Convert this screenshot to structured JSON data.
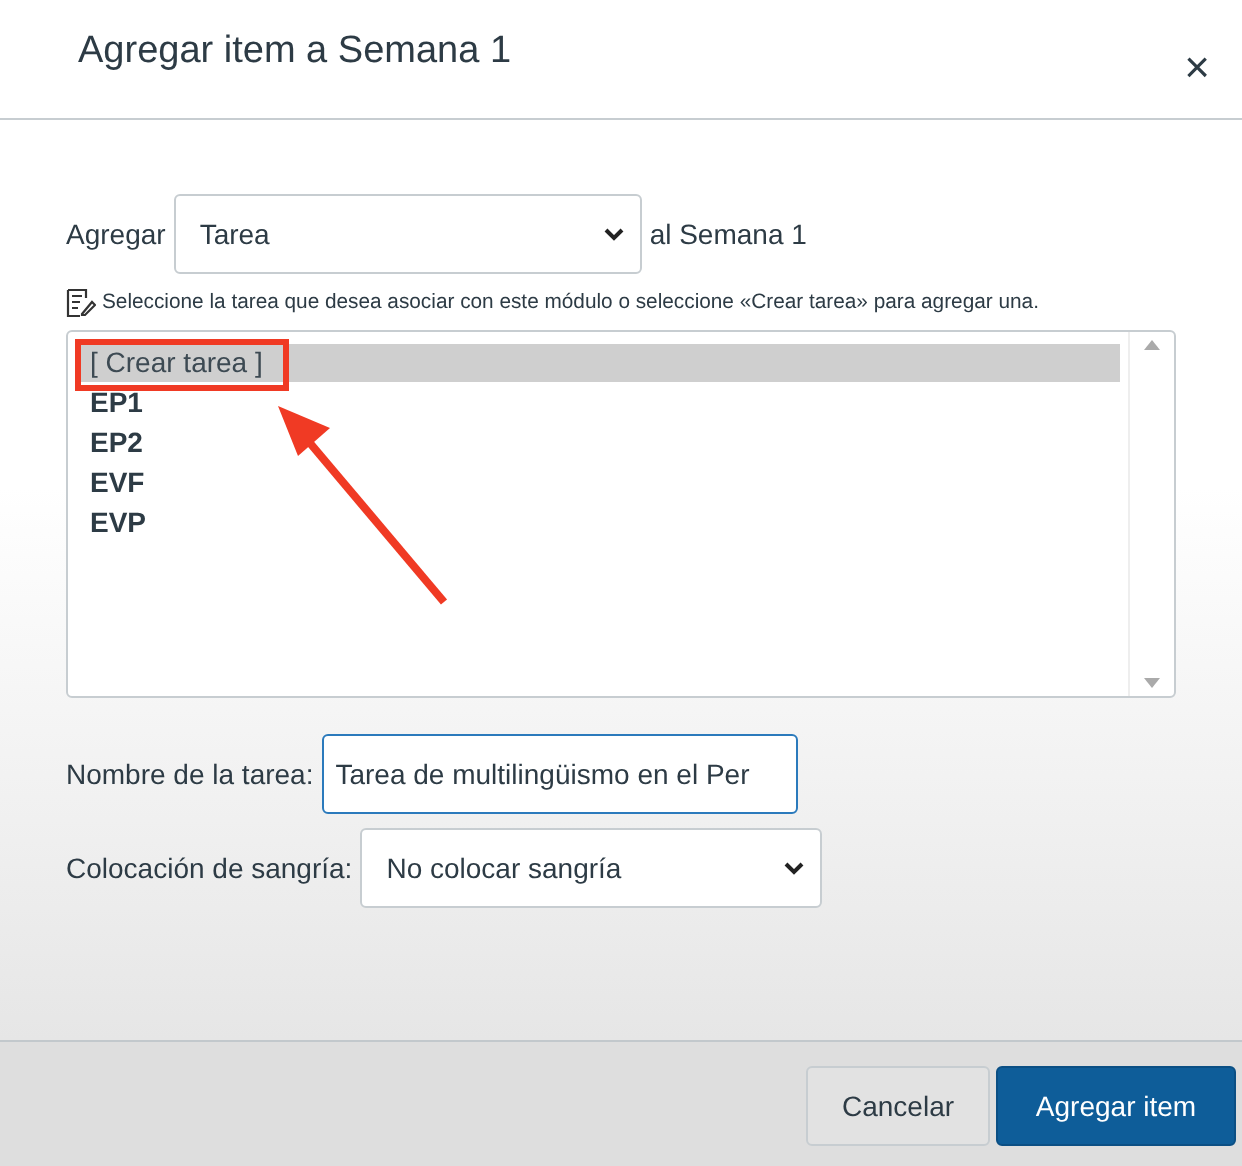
{
  "dialog": {
    "title": "Agregar item a Semana 1",
    "close": "×"
  },
  "add_row": {
    "label": "Agregar",
    "type_select": "Tarea",
    "suffix": "al Semana 1"
  },
  "hint": "Seleccione la tarea que desea asociar con este módulo o seleccione «Crear tarea» para agregar una.",
  "list_items": [
    {
      "label": "[ Crear tarea ]",
      "selected": true
    },
    {
      "label": "EP1",
      "selected": false
    },
    {
      "label": "EP2",
      "selected": false
    },
    {
      "label": "EVF",
      "selected": false
    },
    {
      "label": "EVP",
      "selected": false
    }
  ],
  "name_field": {
    "label": "Nombre de la tarea:",
    "value": "Tarea de multilingüismo en el Per"
  },
  "indent_field": {
    "label": "Colocación de sangría:",
    "value": "No colocar sangría"
  },
  "buttons": [
    {
      "label": "Cancelar",
      "kind": "secondary"
    },
    {
      "label": "Agregar item",
      "kind": "primary"
    }
  ],
  "overlay": {
    "kind": "highlight-arrow"
  }
}
